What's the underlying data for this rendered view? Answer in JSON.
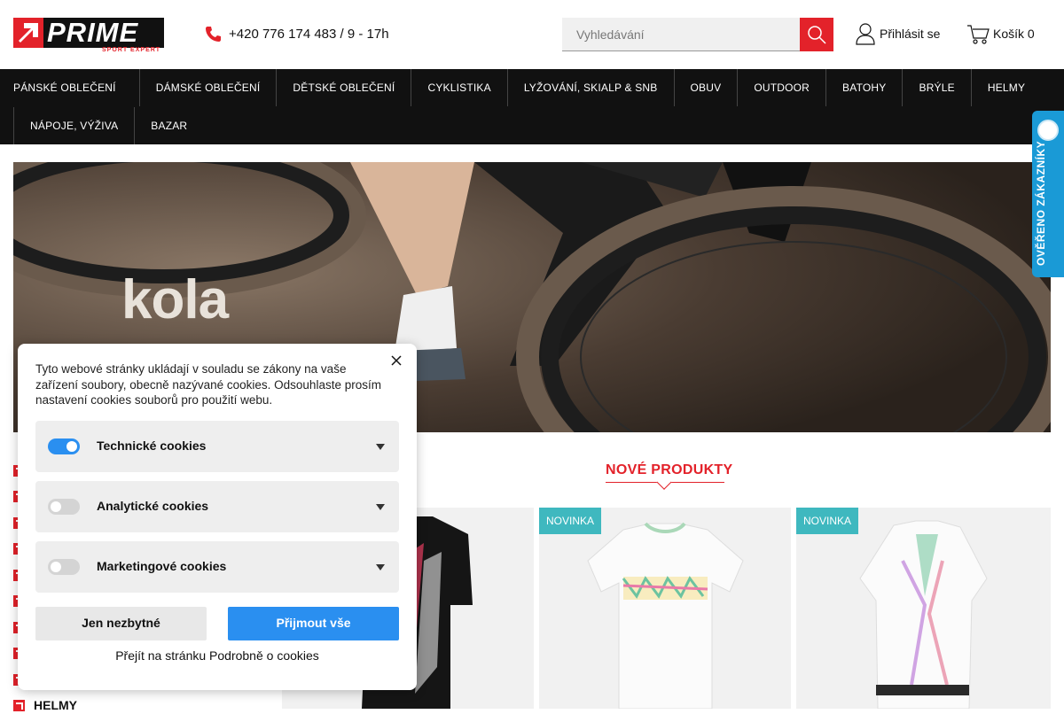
{
  "header": {
    "logo_text": "PRIME",
    "logo_sub": "SPORT EXPERT",
    "phone": "+420 776 174 483 / 9 - 17h",
    "search_placeholder": "Vyhledávání",
    "login_label": "Přihlásit se",
    "cart_label": "Košík 0"
  },
  "nav": {
    "row1": [
      "PÁNSKÉ OBLEČENÍ",
      "DÁMSKÉ OBLEČENÍ",
      "DĚTSKÉ OBLEČENÍ",
      "CYKLISTIKA",
      "LYŽOVÁNÍ, SKIALP & SNB",
      "OBUV",
      "OUTDOOR",
      "BATOHY",
      "BRÝLE",
      "HELMY"
    ],
    "row2": [
      "NÁPOJE, VÝŽIVA",
      "BAZAR"
    ]
  },
  "banner": {
    "text": "kola"
  },
  "trust_badge": {
    "label": "OVĚŘENO ZÁKAZNÍKY"
  },
  "categories": {
    "visible_item": "HELMY"
  },
  "new_products": {
    "title": "NOVÉ PRODUKTY",
    "badge": "NOVINKA"
  },
  "cookie_panel": {
    "text": "Tyto webové stránky ukládají v souladu se zákony na vaše zařízení soubory, obecně nazývané cookies. Odsouhlaste prosím nastavení cookies souborů pro použití webu.",
    "rows": [
      {
        "label": "Technické cookies",
        "enabled": true
      },
      {
        "label": "Analytické cookies",
        "enabled": false
      },
      {
        "label": "Marketingové cookies",
        "enabled": false
      }
    ],
    "btn_necessary": "Jen nezbytné",
    "btn_accept": "Přijmout vše",
    "link": "Přejít na stránku Podrobně o cookies"
  },
  "colors": {
    "brand_red": "#e3222a",
    "nav_bg": "#111111",
    "accept_blue": "#2a8ff0",
    "badge_teal": "#3fb8bf",
    "trust_blue": "#1a9ad6"
  }
}
